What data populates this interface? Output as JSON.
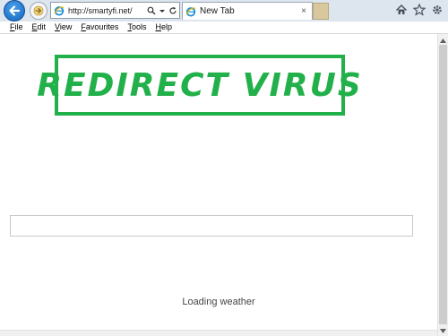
{
  "toolbar": {
    "address": "http://smartyfi.net/",
    "tab_title": "New Tab",
    "tab_close": "×"
  },
  "menu": [
    {
      "label": "File",
      "accel": "F",
      "rest": "ile"
    },
    {
      "label": "Edit",
      "accel": "E",
      "rest": "dit"
    },
    {
      "label": "View",
      "accel": "V",
      "rest": "iew"
    },
    {
      "label": "Favourites",
      "accel": "F",
      "rest": "avourites"
    },
    {
      "label": "Tools",
      "accel": "T",
      "rest": "ools"
    },
    {
      "label": "Help",
      "accel": "H",
      "rest": "elp"
    }
  ],
  "page": {
    "banner_text": "REDIRECT VIRUS",
    "search_value": "",
    "weather_status": "Loading weather"
  },
  "colors": {
    "banner_green": "#22b04a",
    "ie_blue": "#1466c0"
  },
  "icons": [
    "back-arrow-icon",
    "forward-arrow-icon",
    "ie-logo-icon",
    "search-icon",
    "dropdown-icon",
    "refresh-icon",
    "home-icon",
    "favorites-star-icon",
    "settings-gear-icon"
  ]
}
